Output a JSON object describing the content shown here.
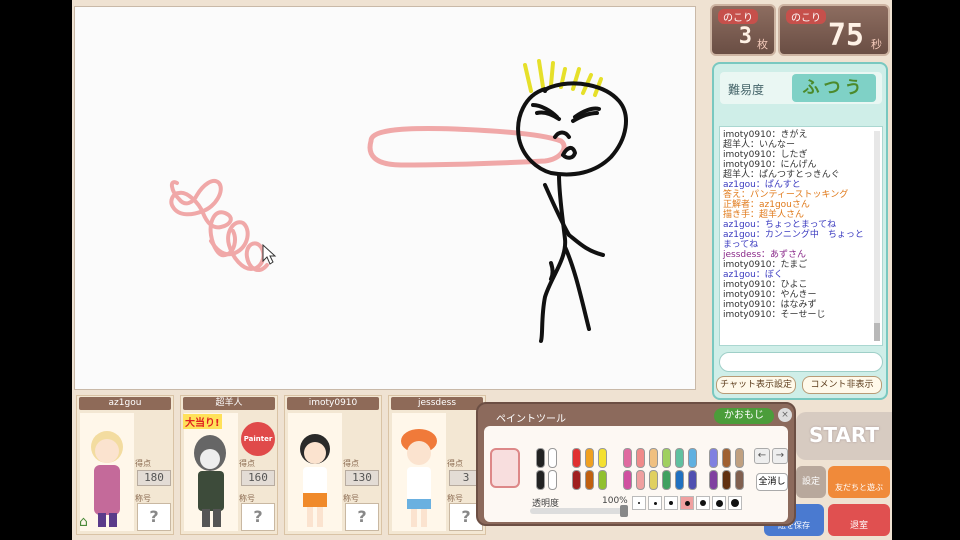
{
  "remaining": {
    "label": "のこり",
    "value": "3",
    "unit": "枚"
  },
  "timer": {
    "label": "のこり",
    "value": "75",
    "unit": "秒"
  },
  "difficulty": {
    "label": "難易度",
    "value": "ふつう"
  },
  "chat": [
    {
      "text": "imoty0910：きがえ",
      "color": "#333333"
    },
    {
      "text": "超羊人：いんなー",
      "color": "#333333"
    },
    {
      "text": "imoty0910：したぎ",
      "color": "#333333"
    },
    {
      "text": "imoty0910：にんげん",
      "color": "#333333"
    },
    {
      "text": "超羊人：ぱんつすとっきんぐ",
      "color": "#333333"
    },
    {
      "text": "az1gou：ぱんすと",
      "color": "#3b3bc0"
    },
    {
      "text": "答え：パンティーストッキング",
      "color": "#e07a1b"
    },
    {
      "text": "正解者：az1gouさん",
      "color": "#e07a1b"
    },
    {
      "text": "描き手：超羊人さん",
      "color": "#e07a1b"
    },
    {
      "text": "az1gou：ちょっとまってね",
      "color": "#3b3bc0"
    },
    {
      "text": "az1gou：カンニング中　ちょっとまってね",
      "color": "#3b3bc0"
    },
    {
      "text": "jessdess：あずさん",
      "color": "#8a2a8a"
    },
    {
      "text": "imoty0910：たまご",
      "color": "#333333"
    },
    {
      "text": "az1gou：ぼく",
      "color": "#3b3bc0"
    },
    {
      "text": "imoty0910：ひよこ",
      "color": "#333333"
    },
    {
      "text": "imoty0910：やんきー",
      "color": "#333333"
    },
    {
      "text": "imoty0910：はなみず",
      "color": "#333333"
    },
    {
      "text": "imoty0910：そーせーじ",
      "color": "#333333"
    }
  ],
  "buttons": {
    "chat_view": "チャット表示設定",
    "comment_hide": "コメント非表示",
    "start": "START",
    "kaomoji": "かおもじ",
    "clear_all": "全消し",
    "friends": "友だちと遊ぶ",
    "exit": "退室",
    "save": "絵を保存",
    "settings": "設定"
  },
  "players": [
    {
      "name": "az1gou",
      "score": "180",
      "title": "?",
      "score_label": "得点",
      "title_label": "称号"
    },
    {
      "name": "超羊人",
      "score": "160",
      "title": "?",
      "score_label": "得点",
      "title_label": "称号",
      "badge": "大当り!",
      "badge2": "Painter"
    },
    {
      "name": "imoty0910",
      "score": "130",
      "title": "?",
      "score_label": "得点",
      "title_label": "称号"
    },
    {
      "name": "jessdess",
      "score": "3",
      "title": "?",
      "score_label": "得点",
      "title_label": "称号"
    }
  ],
  "painttool": {
    "title": "ペイントツール",
    "opacity_label": "透明度",
    "opacity_value": "100%",
    "opacity": 1.0
  },
  "colors": {
    "accent_teal": "#79c8c0",
    "panel_brown": "#8c6a5c",
    "stroke_black": "#111111",
    "stroke_pink": "#f0a8a8",
    "stroke_yellow": "#e6e02a"
  }
}
